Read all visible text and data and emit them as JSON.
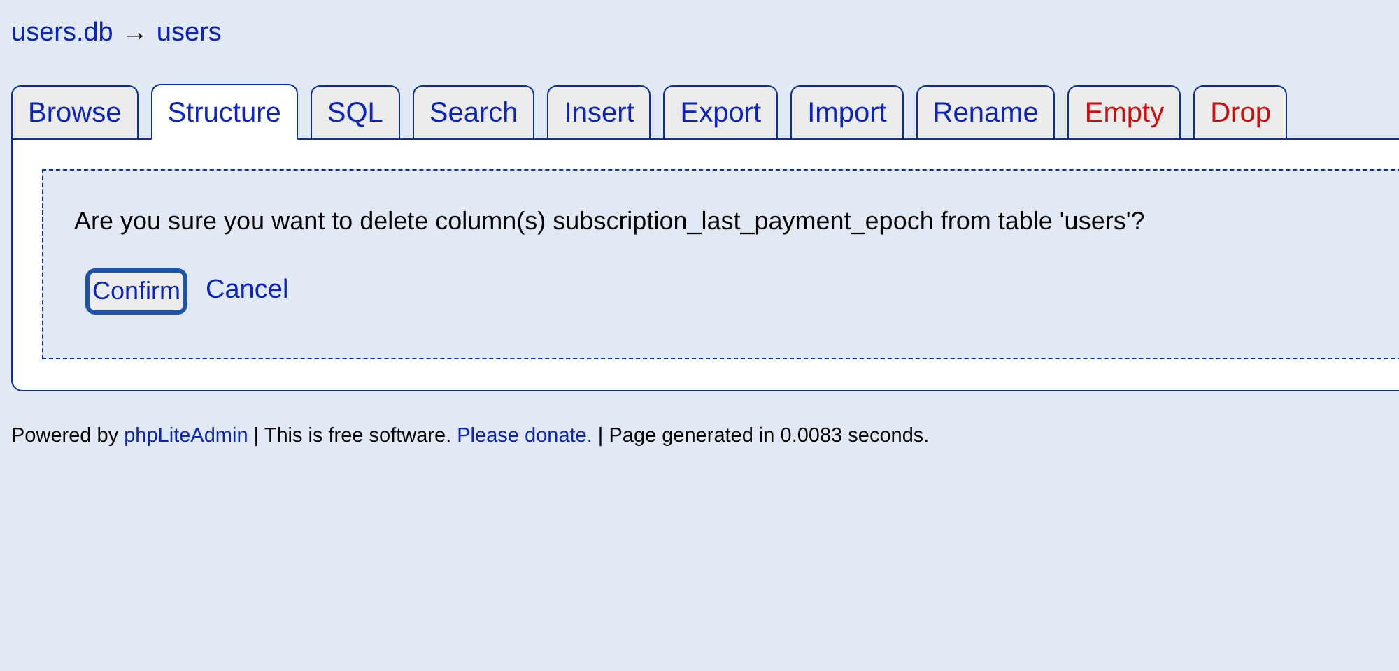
{
  "breadcrumb": {
    "database": "users.db",
    "separator": "→",
    "table": "users"
  },
  "tabs": [
    {
      "label": "Browse",
      "selected": false,
      "kind": "normal"
    },
    {
      "label": "Structure",
      "selected": true,
      "kind": "normal"
    },
    {
      "label": "SQL",
      "selected": false,
      "kind": "normal"
    },
    {
      "label": "Search",
      "selected": false,
      "kind": "normal"
    },
    {
      "label": "Insert",
      "selected": false,
      "kind": "normal"
    },
    {
      "label": "Export",
      "selected": false,
      "kind": "normal"
    },
    {
      "label": "Import",
      "selected": false,
      "kind": "normal"
    },
    {
      "label": "Rename",
      "selected": false,
      "kind": "normal"
    },
    {
      "label": "Empty",
      "selected": false,
      "kind": "danger"
    },
    {
      "label": "Drop",
      "selected": false,
      "kind": "danger"
    }
  ],
  "confirm_dialog": {
    "message": "Are you sure you want to delete column(s) subscription_last_payment_epoch from table 'users'?",
    "confirm_button": "Confirm",
    "cancel_link": "Cancel"
  },
  "footer": [
    {
      "kind": "text",
      "text": "Powered by "
    },
    {
      "kind": "link",
      "text": "phpLiteAdmin"
    },
    {
      "kind": "text",
      "text": " | This is free software. "
    },
    {
      "kind": "link",
      "text": "Please donate."
    },
    {
      "kind": "text",
      "text": " | Page generated in 0.0083 seconds."
    }
  ]
}
